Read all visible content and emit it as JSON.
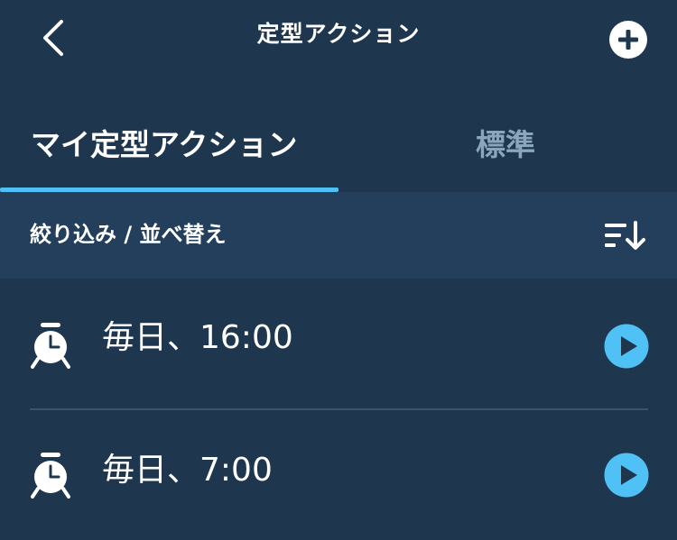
{
  "header": {
    "title": "定型アクション",
    "back_icon": "chevron-left-icon",
    "add_icon": "plus-circle-icon"
  },
  "tabs": [
    {
      "label": "マイ定型アクション",
      "active": true
    },
    {
      "label": "標準",
      "active": false
    }
  ],
  "filter": {
    "label": "絞り込み / 並べ替え",
    "sort_icon": "sort-descending-icon"
  },
  "routines": [
    {
      "label": "毎日、16:00",
      "icon": "alarm-clock-icon",
      "action_icon": "play-icon"
    },
    {
      "label": "毎日、7:00",
      "icon": "alarm-clock-icon",
      "action_icon": "play-icon"
    }
  ],
  "colors": {
    "background": "#1f364f",
    "filter_bar": "#243f5c",
    "accent": "#4fc1f5",
    "inactive_tab": "#8aa6bd",
    "divider": "#3a5470"
  }
}
